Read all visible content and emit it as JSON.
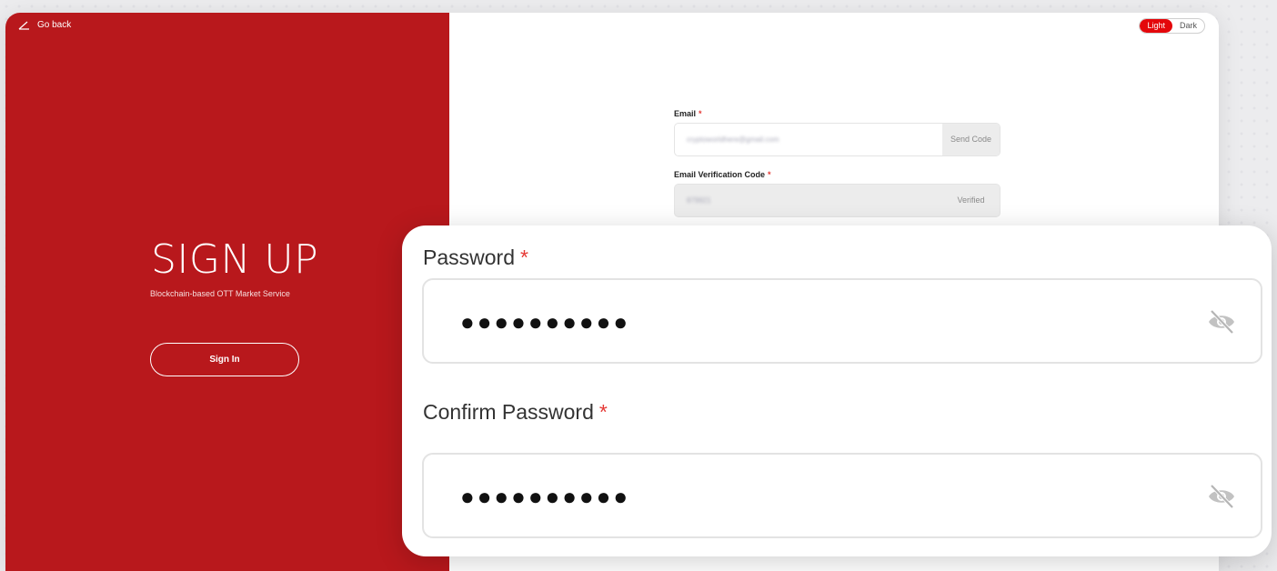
{
  "nav": {
    "go_back": "Go back"
  },
  "theme": {
    "light": "Light",
    "dark": "Dark",
    "active": "light"
  },
  "brand": {
    "title": "SIGN UP",
    "subtitle": "Blockchain-based OTT Market Service",
    "sign_in": "Sign In"
  },
  "form": {
    "email": {
      "label": "Email",
      "required_mark": "*",
      "value": "cryptoworldhere@gmail.com",
      "action": "Send Code"
    },
    "code": {
      "label": "Email Verification Code",
      "required_mark": "*",
      "value": "879921",
      "status": "Verified"
    }
  },
  "zoom": {
    "password": {
      "label": "Password",
      "required_mark": "*",
      "mask": "●●●●●●●●●●"
    },
    "confirm": {
      "label": "Confirm Password",
      "required_mark": "*",
      "mask": "●●●●●●●●●●"
    }
  },
  "colors": {
    "brand_red": "#b8181c",
    "accent_red": "#e4070b",
    "required": "#e53935"
  },
  "icons": {
    "back": "arrow-back-icon",
    "visibility": "eye-off-icon"
  }
}
